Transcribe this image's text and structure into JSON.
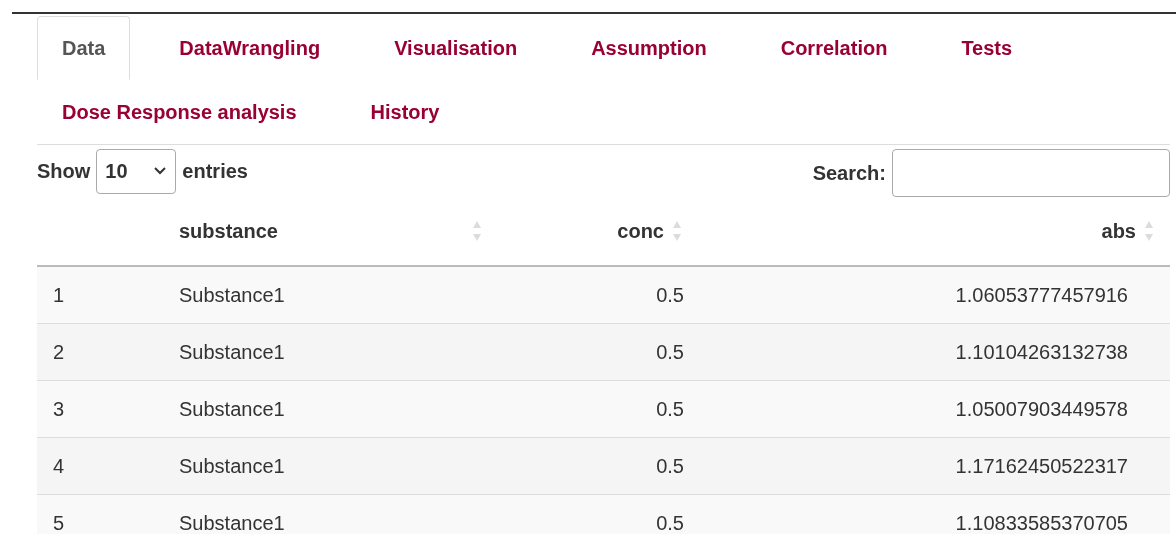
{
  "tabs": [
    {
      "label": "Data",
      "selected": true
    },
    {
      "label": "DataWrangling",
      "selected": false
    },
    {
      "label": "Visualisation",
      "selected": false
    },
    {
      "label": "Assumption",
      "selected": false
    },
    {
      "label": "Correlation",
      "selected": false
    },
    {
      "label": "Tests",
      "selected": false
    },
    {
      "label": "Dose Response analysis",
      "selected": false
    },
    {
      "label": "History",
      "selected": false
    }
  ],
  "length_control": {
    "before": "Show",
    "value": "10",
    "after": "entries"
  },
  "search": {
    "label": "Search:"
  },
  "table": {
    "columns": [
      {},
      {
        "label": "substance"
      },
      {
        "label": "conc"
      },
      {
        "label": "abs"
      }
    ],
    "rows": [
      [
        "1",
        "Substance1",
        "0.5",
        "1.06053777457916"
      ],
      [
        "2",
        "Substance1",
        "0.5",
        "1.10104263132738"
      ],
      [
        "3",
        "Substance1",
        "0.5",
        "1.05007903449578"
      ],
      [
        "4",
        "Substance1",
        "0.5",
        "1.17162450522317"
      ],
      [
        "5",
        "Substance1",
        "0.5",
        "1.10833585370705"
      ]
    ]
  }
}
